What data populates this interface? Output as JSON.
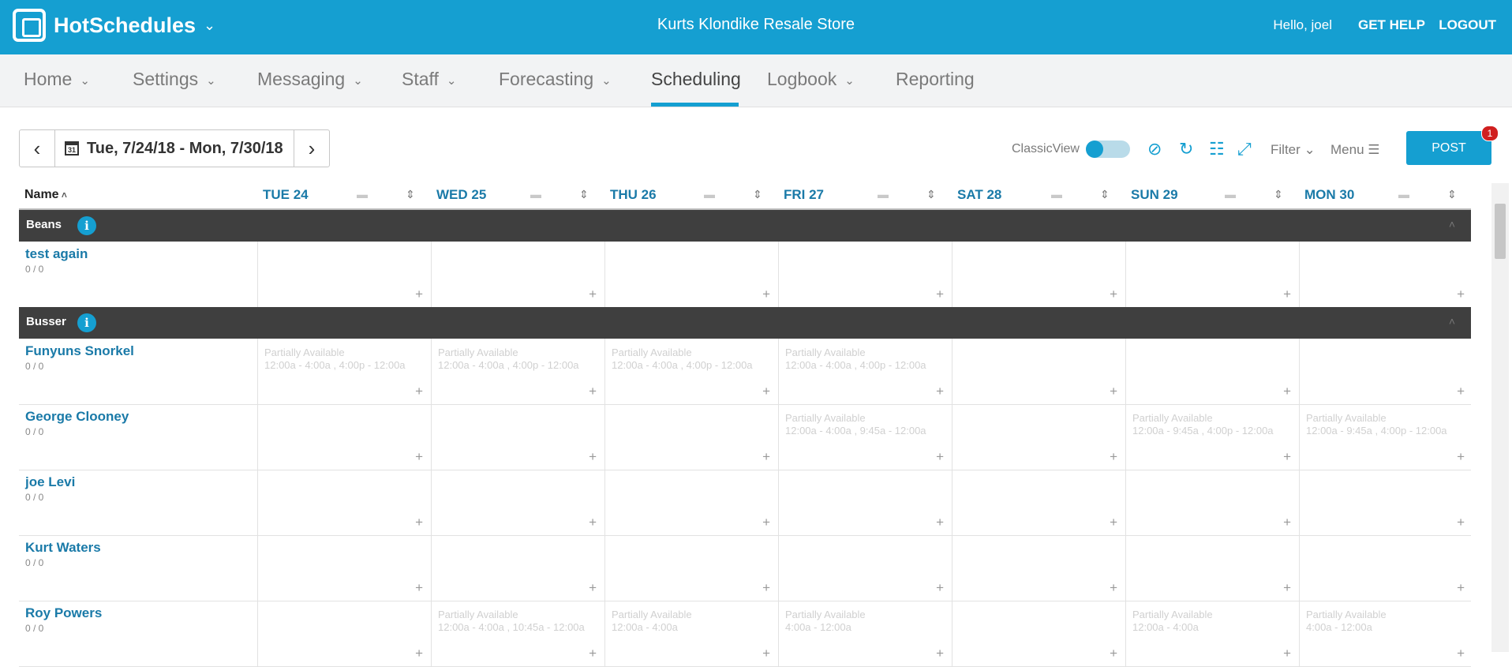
{
  "header": {
    "brand": "HotSchedules",
    "store": "Kurts Klondike Resale Store",
    "greeting": "Hello, joel",
    "get_help": "GET HELP",
    "logout": "LOGOUT"
  },
  "nav": [
    {
      "label": "Home",
      "caret": true
    },
    {
      "label": "Settings",
      "caret": true
    },
    {
      "label": "Messaging",
      "caret": true
    },
    {
      "label": "Staff",
      "caret": true
    },
    {
      "label": "Forecasting",
      "caret": true
    },
    {
      "label": "Scheduling",
      "caret": false,
      "active": true
    },
    {
      "label": "Logbook",
      "caret": true
    },
    {
      "label": "Reporting",
      "caret": false
    }
  ],
  "toolbar": {
    "date_range": "Tue, 7/24/18 - Mon, 7/30/18",
    "classic_view": "ClassicView",
    "filter": "Filter",
    "menu": "Menu",
    "post": "POST",
    "post_badge": "1",
    "calendar_day": "31"
  },
  "grid": {
    "name_header": "Name",
    "days": [
      "TUE 24",
      "WED 25",
      "THU 26",
      "FRI 27",
      "SAT 28",
      "SUN 29",
      "MON 30"
    ],
    "groups": [
      {
        "name": "Beans",
        "employees": [
          {
            "name": "test again",
            "hours": "0 / 0",
            "avail": [
              "",
              "",
              "",
              "",
              "",
              "",
              ""
            ]
          }
        ]
      },
      {
        "name": "Busser",
        "employees": [
          {
            "name": "Funyuns Snorkel",
            "hours": "0 / 0",
            "avail": [
              "Partially Available\n12:00a - 4:00a , 4:00p - 12:00a",
              "Partially Available\n12:00a - 4:00a , 4:00p - 12:00a",
              "Partially Available\n12:00a - 4:00a , 4:00p - 12:00a",
              "Partially Available\n12:00a - 4:00a , 4:00p - 12:00a",
              "",
              "",
              ""
            ]
          },
          {
            "name": "George Clooney",
            "hours": "0 / 0",
            "avail": [
              "",
              "",
              "",
              "Partially Available\n12:00a - 4:00a , 9:45a - 12:00a",
              "",
              "Partially Available\n12:00a - 9:45a , 4:00p - 12:00a",
              "Partially Available\n12:00a - 9:45a , 4:00p - 12:00a"
            ]
          },
          {
            "name": "joe Levi",
            "hours": "0 / 0",
            "avail": [
              "",
              "",
              "",
              "",
              "",
              "",
              ""
            ]
          },
          {
            "name": "Kurt Waters",
            "hours": "0 / 0",
            "avail": [
              "",
              "",
              "",
              "",
              "",
              "",
              ""
            ]
          },
          {
            "name": "Roy Powers",
            "hours": "0 / 0",
            "avail": [
              "",
              "Partially Available\n12:00a - 4:00a , 10:45a - 12:00a",
              "Partially Available\n12:00a - 4:00a",
              "Partially Available\n4:00a - 12:00a",
              "",
              "Partially Available\n12:00a - 4:00a",
              "Partially Available\n4:00a - 12:00a"
            ]
          }
        ]
      }
    ]
  },
  "colors": {
    "brand": "#159fd1",
    "group_bar": "#3f3f3f",
    "link": "#1a7aa8",
    "badge": "#d01f1f"
  }
}
